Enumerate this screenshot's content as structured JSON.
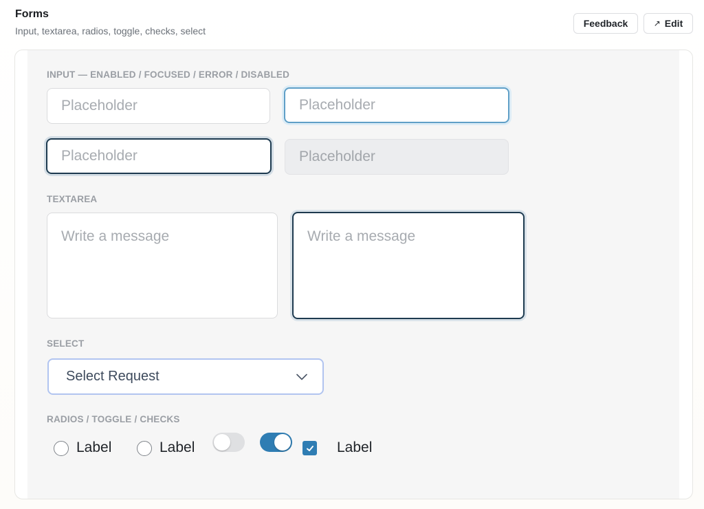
{
  "header": {
    "title": "Forms",
    "subtitle": "Input, textarea, radios, toggle, checks, select",
    "feedback_label": "Feedback",
    "edit_label": "Edit",
    "edit_icon": "arrow-up-right-icon"
  },
  "sections": {
    "input_label": "INPUT — ENABLED / FOCUSED / ERROR / DISABLED",
    "textarea_label": "TEXTAREA",
    "select_label": "SELECT",
    "choices_label": "RADIOS / TOGGLE / CHECKS"
  },
  "inputs": {
    "enabled": {
      "placeholder": "Placeholder",
      "value": ""
    },
    "focused": {
      "placeholder": "Placeholder",
      "value": ""
    },
    "error": {
      "placeholder": "Placeholder",
      "value": ""
    },
    "disabled": {
      "placeholder": "Placeholder",
      "value": ""
    }
  },
  "textareas": {
    "default": {
      "placeholder": "Write a message"
    },
    "active": {
      "placeholder": "Write a message"
    }
  },
  "select": {
    "value": "Select Request",
    "icon": "chevron-down-icon"
  },
  "choices": {
    "radio_1_label": "Label",
    "radio_2_label": "Label",
    "radio_1_checked": false,
    "radio_2_checked": false,
    "toggle_1_on": false,
    "toggle_2_on": true,
    "checkbox_label": "Label",
    "checkbox_checked": true
  },
  "colors": {
    "accent": "#2f7db3",
    "focus_ring": "#5f9fc7",
    "error_border": "#1d3a4f",
    "select_border": "#b1c4f0"
  }
}
